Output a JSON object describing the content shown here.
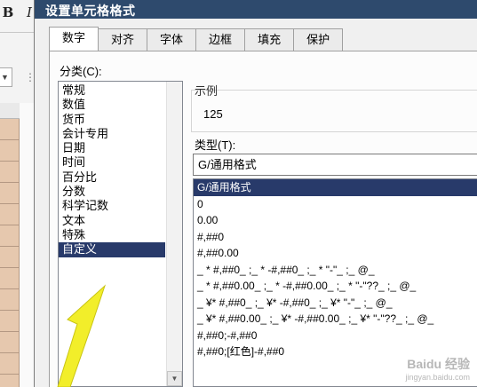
{
  "excel": {
    "bold_label": "B",
    "italic_label": "I"
  },
  "dialog": {
    "title": "设置单元格格式",
    "tabs": [
      {
        "label": "数字",
        "active": true
      },
      {
        "label": "对齐",
        "active": false
      },
      {
        "label": "字体",
        "active": false
      },
      {
        "label": "边框",
        "active": false
      },
      {
        "label": "填充",
        "active": false
      },
      {
        "label": "保护",
        "active": false
      }
    ],
    "category_label": "分类(C):",
    "categories": [
      {
        "label": "常规",
        "selected": false
      },
      {
        "label": "数值",
        "selected": false
      },
      {
        "label": "货币",
        "selected": false
      },
      {
        "label": "会计专用",
        "selected": false
      },
      {
        "label": "日期",
        "selected": false
      },
      {
        "label": "时间",
        "selected": false
      },
      {
        "label": "百分比",
        "selected": false
      },
      {
        "label": "分数",
        "selected": false
      },
      {
        "label": "科学记数",
        "selected": false
      },
      {
        "label": "文本",
        "selected": false
      },
      {
        "label": "特殊",
        "selected": false
      },
      {
        "label": "自定义",
        "selected": true
      }
    ],
    "sample_label": "示例",
    "sample_value": "125",
    "type_label": "类型(T):",
    "type_input_value": "G/通用格式",
    "type_formats": [
      {
        "label": "G/通用格式",
        "selected": true
      },
      {
        "label": "0",
        "selected": false
      },
      {
        "label": "0.00",
        "selected": false
      },
      {
        "label": "#,##0",
        "selected": false
      },
      {
        "label": "#,##0.00",
        "selected": false
      },
      {
        "label": "_ * #,##0_ ;_ * -#,##0_ ;_ * \"-\"_ ;_ @_",
        "selected": false
      },
      {
        "label": "_ * #,##0.00_ ;_ * -#,##0.00_ ;_ * \"-\"??_ ;_ @_",
        "selected": false
      },
      {
        "label": "_ ¥* #,##0_ ;_ ¥* -#,##0_ ;_ ¥* \"-\"_ ;_ @_",
        "selected": false
      },
      {
        "label": "_ ¥* #,##0.00_ ;_ ¥* -#,##0.00_ ;_ ¥* \"-\"??_ ;_ @_",
        "selected": false
      },
      {
        "label": "#,##0;-#,##0",
        "selected": false
      },
      {
        "label": "#,##0;[红色]-#,##0",
        "selected": false
      }
    ]
  },
  "watermark": {
    "name": "Baidu 经验",
    "site": "jingyan.baidu.com"
  },
  "colors": {
    "titlebar": "#2e4a6d",
    "selection": "#283a6a",
    "cell_fill": "#e6c8ae",
    "arrow": "#f2ee2a"
  }
}
